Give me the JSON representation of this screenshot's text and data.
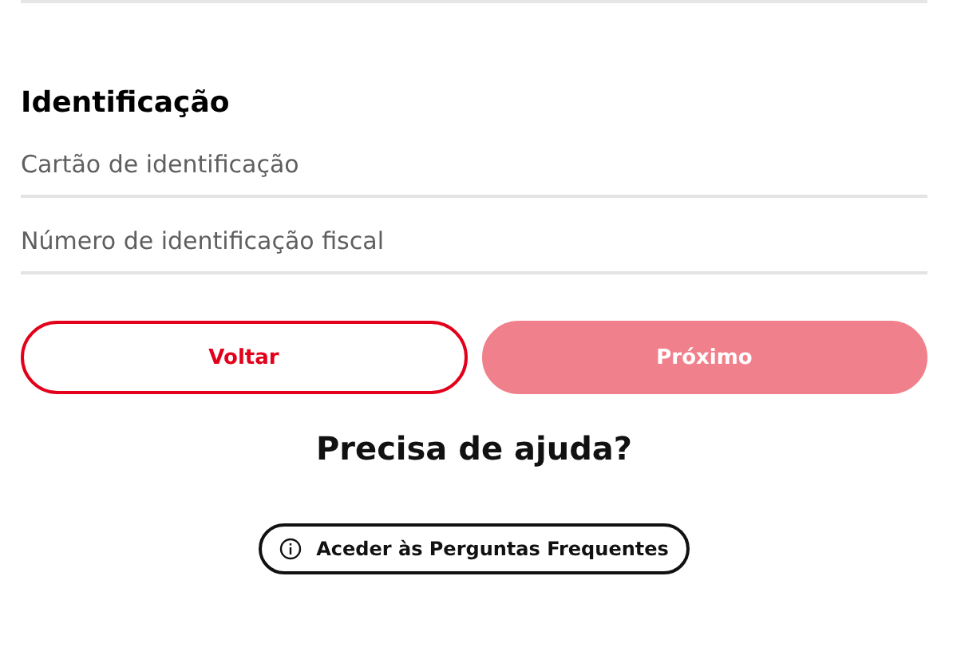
{
  "section": {
    "title": "Identificação"
  },
  "fields": [
    {
      "placeholder": "Cartão de identificação"
    },
    {
      "placeholder": "Número de identificação fiscal"
    }
  ],
  "buttons": [
    {
      "label": "Voltar",
      "kind": "outline",
      "disabled": false
    },
    {
      "label": "Próximo",
      "kind": "primary",
      "disabled": true
    }
  ],
  "help": {
    "title": "Precisa de ajuda?",
    "link": "Aceder às Perguntas Frequentes"
  }
}
